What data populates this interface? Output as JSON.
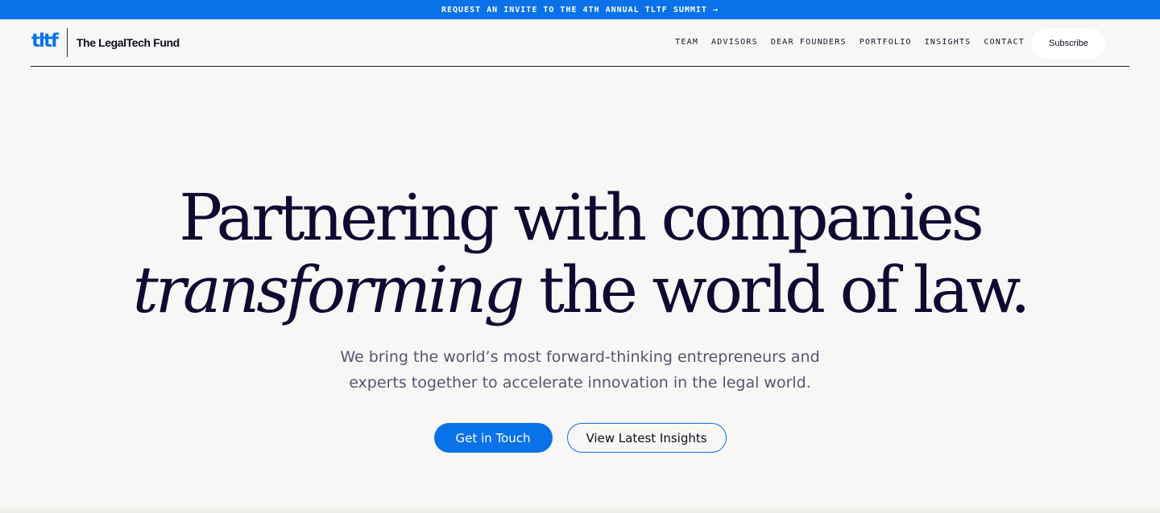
{
  "announcement": {
    "text": "REQUEST AN INVITE TO THE 4TH ANNUAL TLTF SUMMIT →"
  },
  "header": {
    "logo_text": "tltf",
    "brand_name": "The LegalTech Fund",
    "nav": [
      {
        "label": "TEAM"
      },
      {
        "label": "ADVISORS"
      },
      {
        "label": "DEAR FOUNDERS"
      },
      {
        "label": "PORTFOLIO"
      },
      {
        "label": "INSIGHTS"
      },
      {
        "label": "CONTACT"
      }
    ],
    "subscribe_label": "Subscribe"
  },
  "hero": {
    "headline_line1": "Partnering with companies",
    "headline_italic": "transforming",
    "headline_line2_rest": " the world of law.",
    "subtext": "We bring the world’s most forward-thinking entrepreneurs and experts together to accelerate innovation in the legal world.",
    "primary_cta": "Get in Touch",
    "secondary_cta": "View Latest Insights"
  },
  "colors": {
    "accent": "#0a72e8",
    "background": "#f8f7f5",
    "headline": "#0e0b33",
    "body_text": "#55556e"
  }
}
